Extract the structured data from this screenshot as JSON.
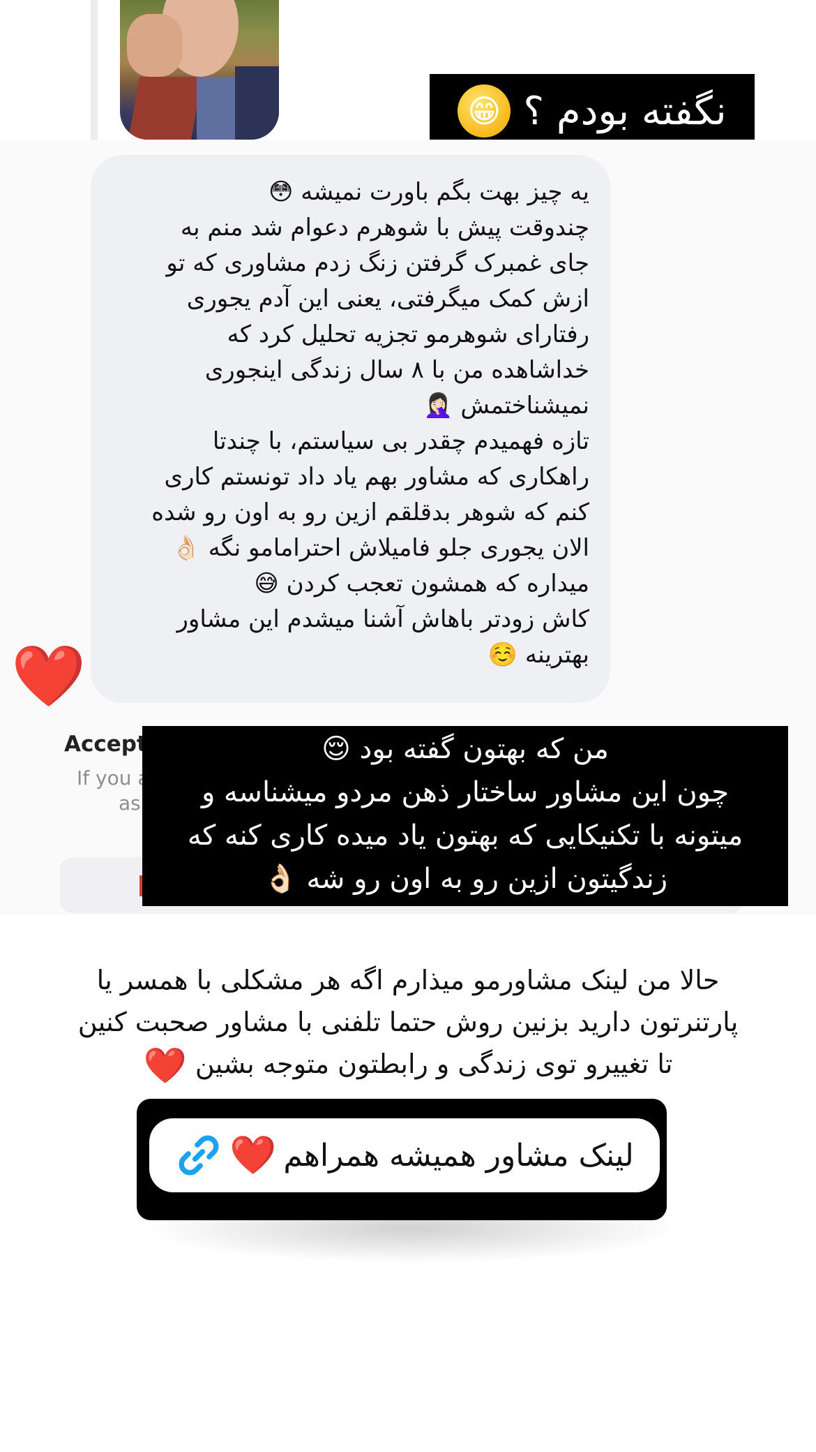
{
  "caption_top": {
    "text": "نگفته بودم ؟",
    "emoji": "😁"
  },
  "message": {
    "lines": [
      "یه چیز بهت بگم باورت نمیشه 😳",
      "چندوقت پیش با شوهرم دعوام شد منم به",
      "جای غمبرک گرفتن زنگ زدم مشاوری که تو",
      "ازش کمک میگرفتی، یعنی این آدم یجوری",
      "رفتارای شوهرمو تجزیه تحلیل کرد که",
      "خداشاهده من با ۸ سال زندگی اینجوری",
      "نمیشناختمش 🤦🏻‍♀️",
      "تازه فهمیدم چقدر بی سیاستم، با چندتا",
      "راهکاری که مشاور بهم یاد داد تونستم کاری",
      "کنم که شوهر بدقلقم ازین رو به اون رو شده",
      "الان یجوری جلو فامیلاش احترامامو نگه 👌🏻",
      "میداره که همشون تعجب کردن 😅",
      "کاش زودتر باهاش آشنا میشدم این مشاور",
      "بهترینه ☺️"
    ],
    "reaction": "❤️"
  },
  "dialog": {
    "title": "Accept",
    "body_line1": "If you a",
    "body_line2": "as"
  },
  "caption_mid": {
    "lines": [
      "من که بهتون گفته بود 😌",
      "چون این مشاور ساختار ذهن مردو میشناسه و",
      "میتونه با تکنیکایی که بهتون یاد میده کاری کنه که",
      "زندگیتون ازین رو به اون رو شه 👌🏻"
    ]
  },
  "paragraph": {
    "lines": [
      "حالا من لینک مشاورمو میذارم اگه هر مشکلی با همسر یا",
      "پارتنرتون دارید بزنین روش حتما تلفنی با مشاور صحبت کنین",
      "تا تغییرو توی زندگی و رابطتون متوجه بشین"
    ],
    "heart": "❤️"
  },
  "link_button": {
    "label": "لینک مشاور همیشه همراهم",
    "heart": "❤️",
    "icon": "link-icon"
  },
  "colors": {
    "accent_blue": "#1da1f2",
    "heart_red": "#e4202a",
    "bubble_gray": "#eff0f3"
  }
}
